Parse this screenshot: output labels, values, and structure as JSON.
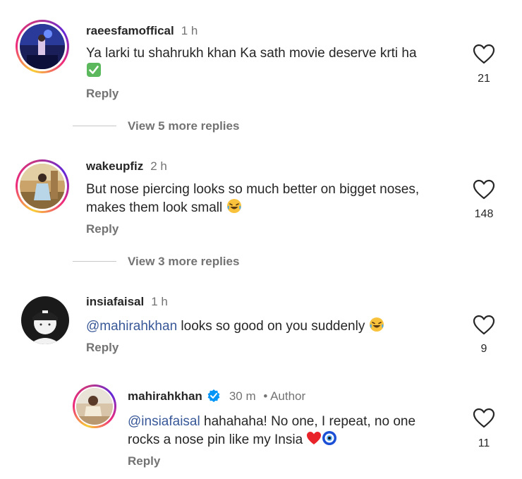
{
  "comments": [
    {
      "username": "raeesfamoffical",
      "time": "1 h",
      "text": "Ya larki tu shahrukh khan Ka sath movie deserve krti ha",
      "reply_label": "Reply",
      "likes": "21",
      "view_more": "View 5 more replies"
    },
    {
      "username": "wakeupfiz",
      "time": "2 h",
      "text_line1": "But nose piercing looks so much better on bigget noses,",
      "text_line2": "makes them look small",
      "reply_label": "Reply",
      "likes": "148",
      "view_more": "View 3 more replies"
    },
    {
      "username": "insiafaisal",
      "time": "1 h",
      "mention": "@mahirahkhan",
      "text": " looks so good on you suddenly",
      "reply_label": "Reply",
      "likes": "9"
    },
    {
      "username": "mahirahkhan",
      "time": "30 m",
      "author_label": "• Author",
      "mention": "@insiafaisal",
      "text_line1": " hahahaha! No one, I repeat, no one",
      "text_line2": "rocks a nose pin like my Insia",
      "reply_label": "Reply",
      "likes": "11"
    }
  ],
  "colors": {
    "mention": "#385898",
    "secondary": "#737373",
    "verified": "#0095f6"
  },
  "icons": [
    "heart-icon",
    "check-mark-emoji",
    "laughing-emoji",
    "red-heart-emoji",
    "nazar-amulet-emoji",
    "verified-badge-icon"
  ]
}
